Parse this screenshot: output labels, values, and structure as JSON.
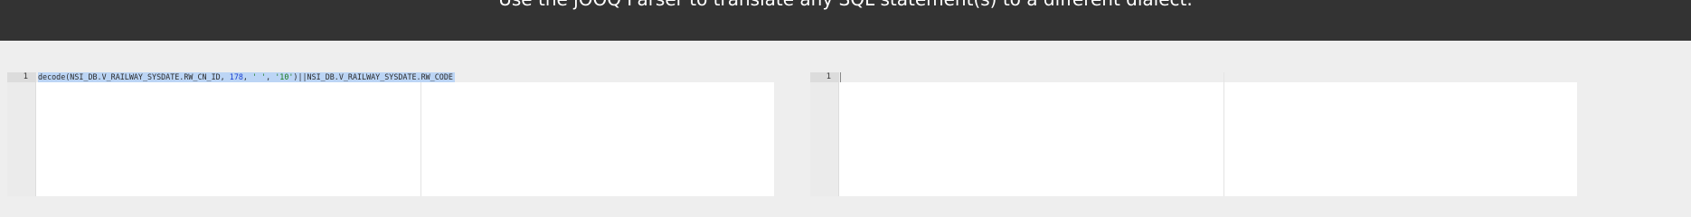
{
  "header": {
    "description": "Use the jOOQ Parser to translate any SQL statement(s) to a different dialect."
  },
  "input_editor": {
    "line_numbers": [
      "1"
    ],
    "code_tokens": [
      {
        "text": "decode(NSI_DB.V_RAILWAY_SYSDATE.RW_CN_ID, ",
        "type": "plain"
      },
      {
        "text": "178",
        "type": "number"
      },
      {
        "text": ", ",
        "type": "plain"
      },
      {
        "text": "' '",
        "type": "string"
      },
      {
        "text": ", ",
        "type": "plain"
      },
      {
        "text": "'10'",
        "type": "string"
      },
      {
        "text": ")||NSI_DB.V_RAILWAY_SYSDATE.RW_CODE",
        "type": "plain"
      }
    ]
  },
  "output_editor": {
    "line_numbers": [
      "1"
    ],
    "code": ""
  },
  "colors": {
    "header_bg": "#333333",
    "page_bg": "#eeeeee",
    "selection": "#bcd5f5",
    "number": "#1a3fd1",
    "string": "#1a7a1a"
  }
}
